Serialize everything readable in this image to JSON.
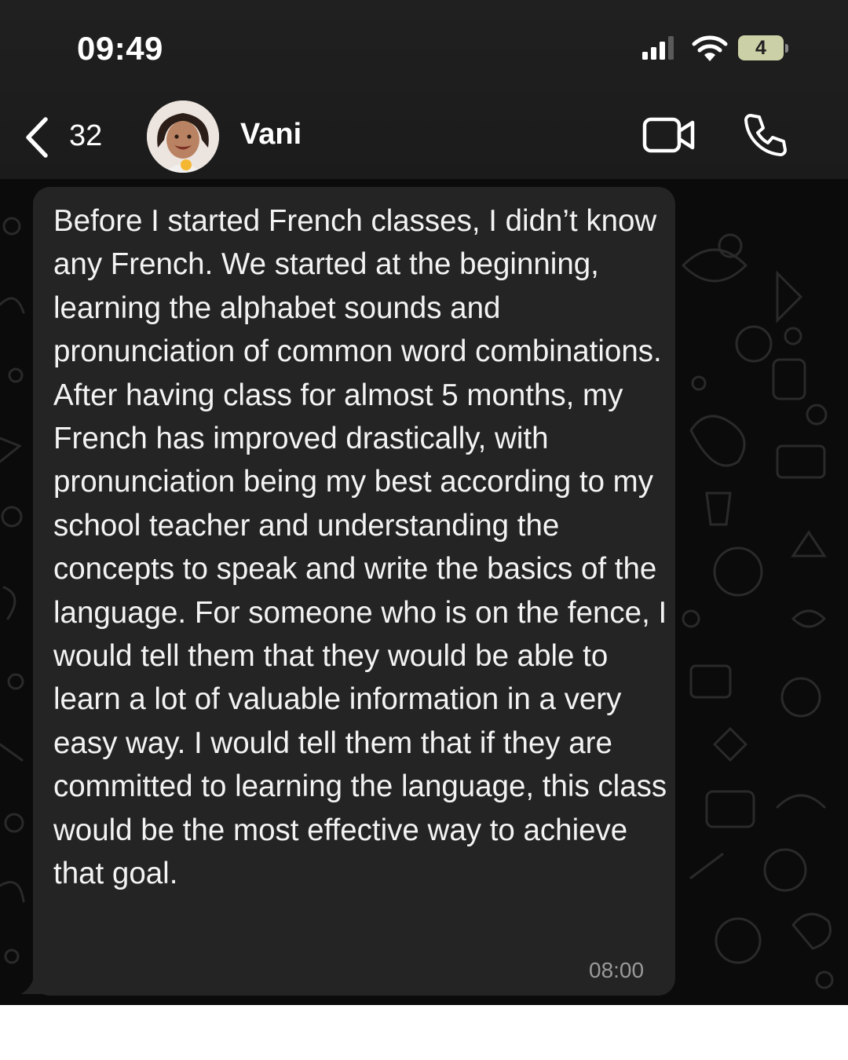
{
  "status_bar": {
    "time": "09:49",
    "battery_level": "4",
    "icons": [
      "cellular-signal-icon",
      "wifi-icon",
      "battery-icon"
    ]
  },
  "header": {
    "back_count": "32",
    "contact_name": "Vani",
    "icons": [
      "chevron-left-icon",
      "video-camera-icon",
      "phone-icon"
    ]
  },
  "message": {
    "text": "Before I started French classes, I didn’t know any French. We started at the beginning, learning the alphabet sounds and pronunciation of common word combinations. After having class for almost 5 months, my French has improved drastically, with pronunciation being my best according to my school teacher and understanding the concepts to speak and write the basics of the language. For someone who is on the fence, I would tell them that they would be able to learn a lot of valuable information in a very easy way. I would tell them that if they are committed to learning the language, this class would be the most effective way to achieve that goal.",
    "time": "08:00"
  },
  "colors": {
    "chat_background": "#0b0b0b",
    "header_background": "#1e1e1e",
    "bubble_background": "#242424",
    "text": "#f3f3f3",
    "timestamp": "#9a9a9a",
    "battery_fill": "#ccd0a6"
  }
}
